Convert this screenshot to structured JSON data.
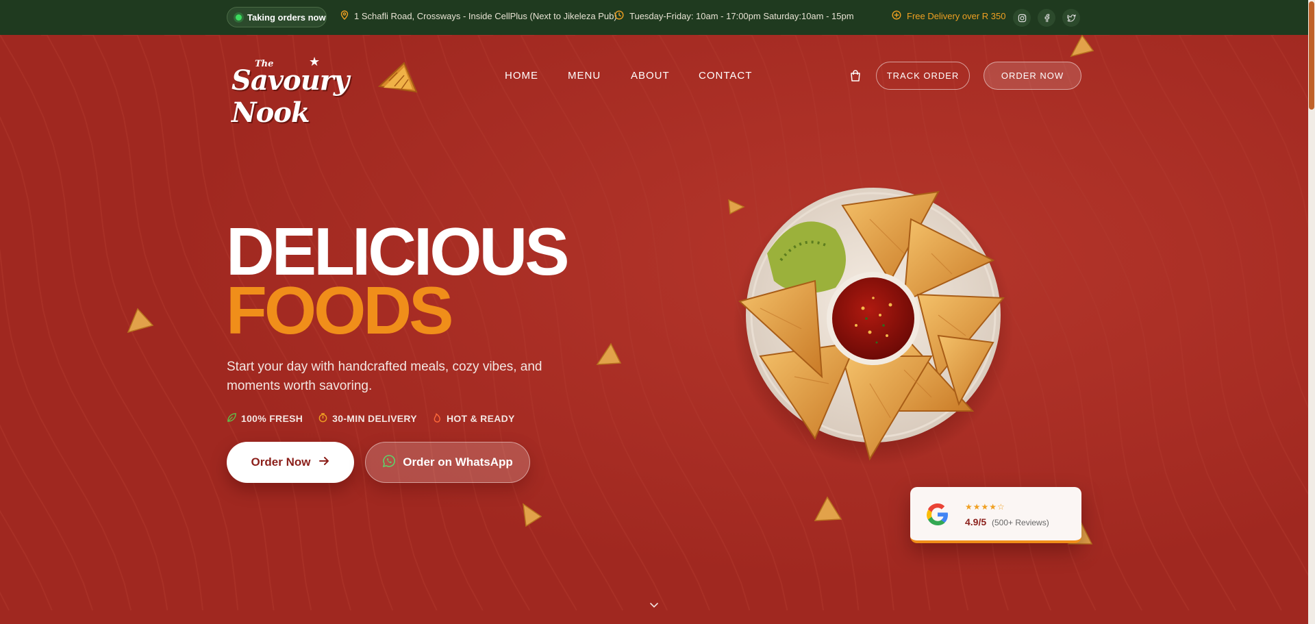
{
  "topbar": {
    "status": "Taking orders now",
    "address": "1 Schafli Road, Crossways - Inside CellPlus (Next to Jikeleza Pub)",
    "hours": "Tuesday-Friday: 10am - 17:00pm Saturday:10am - 15pm",
    "delivery": "Free Delivery over R 350",
    "social": [
      {
        "icon": "instagram-icon"
      },
      {
        "icon": "facebook-icon"
      },
      {
        "icon": "twitter-icon"
      }
    ]
  },
  "logo": {
    "small": "The",
    "main": "Savoury Nook"
  },
  "nav": {
    "items": [
      {
        "label": "HOME"
      },
      {
        "label": "MENU"
      },
      {
        "label": "ABOUT"
      },
      {
        "label": "CONTACT"
      }
    ]
  },
  "header_actions": {
    "track": "TRACK ORDER",
    "order": "ORDER NOW"
  },
  "hero": {
    "headline_line1": "DELICIOUS",
    "headline_line2": "FOODS",
    "subtitle": "Start your day with handcrafted meals, cozy vibes, and moments worth savoring.",
    "features": [
      {
        "icon": "leaf-icon",
        "label": "100% FRESH"
      },
      {
        "icon": "timer-icon",
        "label": "30-MIN DELIVERY"
      },
      {
        "icon": "flame-icon",
        "label": "HOT & READY"
      }
    ],
    "cta_primary": "Order Now",
    "cta_whatsapp": "Order on WhatsApp"
  },
  "review": {
    "stars": "★★★★☆",
    "rating": "4.9/5",
    "count": "(500+ Reviews)"
  },
  "colors": {
    "topbar": "#1f3a1f",
    "hero_bg": "#a42a22",
    "accent_orange": "#f08e1a",
    "status_green": "#3ddc5f"
  }
}
